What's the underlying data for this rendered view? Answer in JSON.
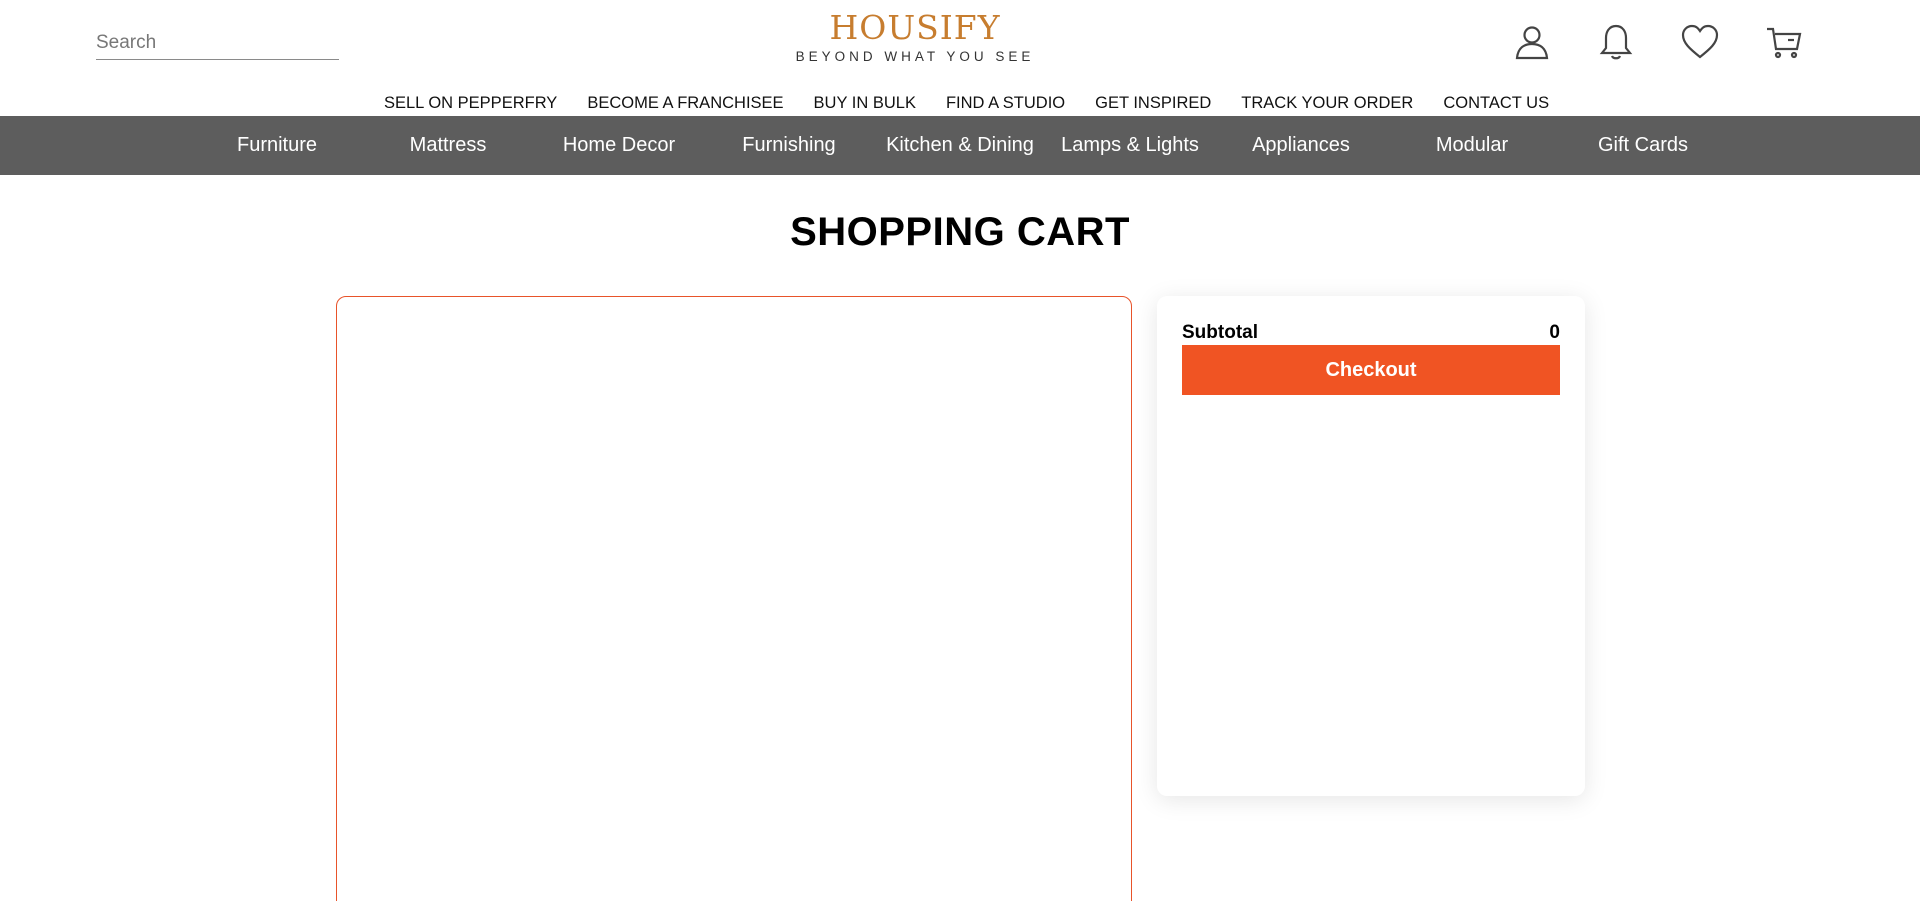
{
  "search": {
    "placeholder": "Search"
  },
  "brand": {
    "name": "HOUSIFY",
    "tagline": "BEYOND WHAT YOU SEE",
    "color": "#c77d2f"
  },
  "header_icons": [
    "user-icon",
    "bell-icon",
    "heart-icon",
    "cart-icon"
  ],
  "top_links": [
    "SELL ON PEPPERFRY",
    "BECOME A FRANCHISEE",
    "BUY IN BULK",
    "FIND A STUDIO",
    "GET INSPIRED",
    "TRACK YOUR ORDER",
    "CONTACT US"
  ],
  "categories": [
    "Furniture",
    "Mattress",
    "Home Decor",
    "Furnishing",
    "Kitchen & Dining",
    "Lamps & Lights",
    "Appliances",
    "Modular",
    "Gift Cards"
  ],
  "page": {
    "title": "SHOPPING CART"
  },
  "summary": {
    "subtotal_label": "Subtotal",
    "subtotal_value": "0",
    "checkout_label": "Checkout"
  },
  "colors": {
    "accent": "#f05423",
    "nav_bg": "#5d5d5d"
  }
}
